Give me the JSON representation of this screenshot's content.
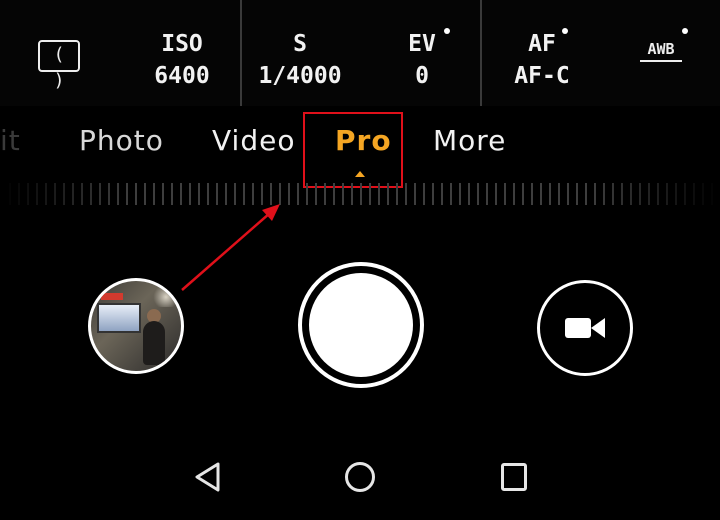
{
  "settings": {
    "aspect_icon": "( )",
    "iso": {
      "label": "ISO",
      "value": "6400"
    },
    "shutter": {
      "label": "S",
      "value": "1/4000"
    },
    "ev": {
      "label": "EV",
      "value": "0"
    },
    "af": {
      "label": "AF",
      "value": "AF-C"
    },
    "awb": {
      "label": "AWB"
    }
  },
  "modes": {
    "items": [
      "it",
      "Photo",
      "Video",
      "Pro",
      "More"
    ],
    "selected": "Pro"
  },
  "colors": {
    "active_mode": "#f5a623",
    "highlight": "#e0101a",
    "background": "#000000"
  },
  "icons": {
    "video": "video-camera-icon",
    "nav_back": "triangle-back-icon",
    "nav_home": "circle-home-icon",
    "nav_recent": "square-recents-icon"
  }
}
